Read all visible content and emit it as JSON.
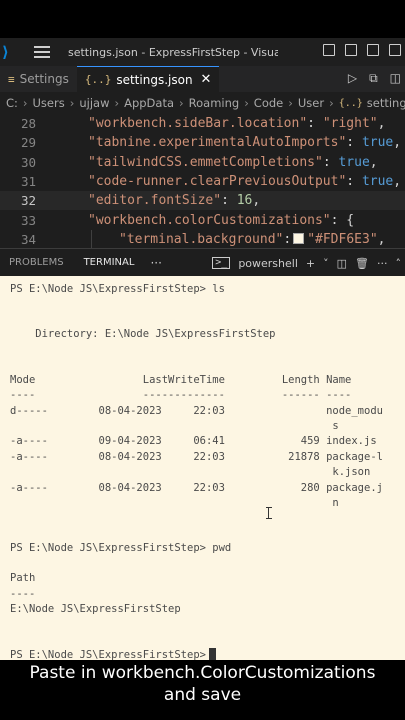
{
  "titlebar": {
    "title": "settings.json - ExpressFirstStep - Visual St..."
  },
  "tabs": [
    {
      "label": "Settings",
      "active": false
    },
    {
      "label": "settings.json",
      "active": true,
      "icon": "{..}"
    }
  ],
  "breadcrumb": [
    "C:",
    "Users",
    "ujjaw",
    "AppData",
    "Roaming",
    "Code",
    "User",
    "settings.json",
    "..."
  ],
  "editor": {
    "lines": [
      {
        "num": "28",
        "key": "\"workbench.sideBar.location\"",
        "sep": ": ",
        "value": "\"right\"",
        "vtype": "str",
        "end": ","
      },
      {
        "num": "29",
        "key": "\"tabnine.experimentalAutoImports\"",
        "sep": ": ",
        "value": "true",
        "vtype": "kw",
        "end": ","
      },
      {
        "num": "30",
        "key": "\"tailwindCSS.emmetCompletions\"",
        "sep": ": ",
        "value": "true",
        "vtype": "kw",
        "end": ","
      },
      {
        "num": "31",
        "key": "\"code-runner.clearPreviousOutput\"",
        "sep": ": ",
        "value": "true",
        "vtype": "kw",
        "end": ","
      },
      {
        "num": "32",
        "key": "\"editor.fontSize\"",
        "sep": ": ",
        "value": "16",
        "vtype": "num",
        "end": ","
      },
      {
        "num": "33",
        "key": "\"workbench.colorCustomizations\"",
        "sep": ": ",
        "value": "{",
        "vtype": "punc",
        "end": ""
      },
      {
        "num": "34",
        "key": "\"terminal.background\"",
        "sep": ":",
        "value": "\"#FDF6E3\"",
        "vtype": "str",
        "end": ","
      }
    ],
    "current_line": "32",
    "swatch_color": "#FDF6E3"
  },
  "panel": {
    "tabs": [
      "PROBLEMS",
      "TERMINAL",
      "···"
    ],
    "active_tab": "TERMINAL",
    "shell": "powershell",
    "add": "+",
    "split_menu": "˅"
  },
  "terminal": {
    "lines": [
      "PS E:\\Node JS\\ExpressFirstStep> ls",
      "    Directory: E:\\Node JS\\ExpressFirstStep",
      "Mode                 LastWriteTime         Length Name",
      "----                 -------------         ------ ----",
      "d-----        08-04-2023     22:03                node_modu",
      "                                                   s",
      "-a----        09-04-2023     06:41            459 index.js",
      "-a----        08-04-2023     22:03          21878 package-l",
      "                                                   k.json",
      "-a----        08-04-2023     22:03            280 package.j",
      "                                                   n",
      "PS E:\\Node JS\\ExpressFirstStep> pwd",
      "Path",
      "----",
      "E:\\Node JS\\ExpressFirstStep",
      "PS E:\\Node JS\\ExpressFirstStep>"
    ]
  },
  "caption": {
    "line1": "Paste in workbench.ColorCustomizations",
    "line2": "and save"
  },
  "colors": {
    "terminal_bg": "#fdf6e3",
    "editor_bg": "#1e1e1e",
    "string": "#ce9178",
    "keyword": "#569cd6",
    "number": "#b5cea8"
  }
}
